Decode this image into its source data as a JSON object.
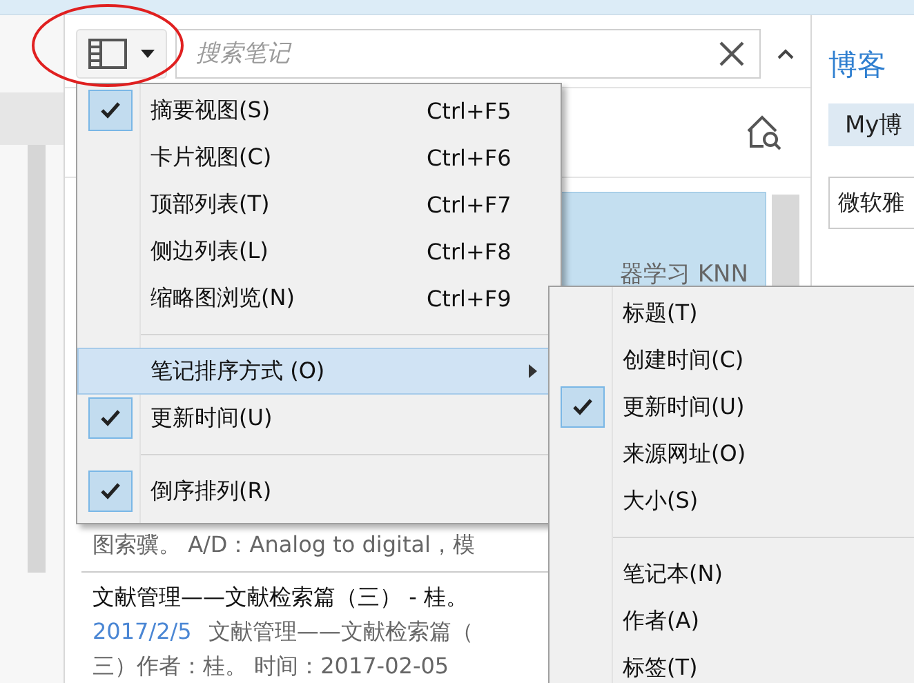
{
  "toolbar": {
    "search": {
      "placeholder": "搜索笔记"
    }
  },
  "notes": [
    {
      "kind": "card",
      "selected": true,
      "title": "器学习 KNN"
    },
    {
      "kind": "snippet",
      "selected": false,
      "text": "图索骥。 A/D：Analog to digital，模"
    },
    {
      "kind": "entry",
      "selected": false,
      "title": "文献管理——文献检索篇（三） - 桂。",
      "date": "2017/2/5",
      "text": "文献管理——文献检索篇（",
      "text_2": "三）作者：桂。 时间：2017-02-05"
    }
  ],
  "right_panel": {
    "heading": "博客",
    "chip": "My博",
    "field_value": "微软雅"
  },
  "view_menu": [
    {
      "kind": "item",
      "label": "摘要视图(S)",
      "shortcut": "Ctrl+F5",
      "checked": true,
      "selected": false
    },
    {
      "kind": "item",
      "label": "卡片视图(C)",
      "shortcut": "Ctrl+F6",
      "checked": false,
      "selected": false
    },
    {
      "kind": "item",
      "label": "顶部列表(T)",
      "shortcut": "Ctrl+F7",
      "checked": false,
      "selected": false
    },
    {
      "kind": "item",
      "label": "侧边列表(L)",
      "shortcut": "Ctrl+F8",
      "checked": false,
      "selected": false
    },
    {
      "kind": "item",
      "label": "缩略图浏览(N)",
      "shortcut": "Ctrl+F9",
      "checked": false,
      "selected": false
    },
    {
      "kind": "separator"
    },
    {
      "kind": "submenu",
      "label": "笔记排序方式 (O)",
      "checked": false,
      "selected": true
    },
    {
      "kind": "item",
      "label": "更新时间(U)",
      "checked": true,
      "selected": false
    },
    {
      "kind": "separator"
    },
    {
      "kind": "item",
      "label": "倒序排列(R)",
      "checked": true,
      "selected": false
    }
  ],
  "sort_menu": [
    {
      "kind": "item",
      "label": "标题(T)",
      "checked": false,
      "selected": false
    },
    {
      "kind": "item",
      "label": "创建时间(C)",
      "checked": false,
      "selected": false
    },
    {
      "kind": "item",
      "label": "更新时间(U)",
      "checked": true,
      "selected": false
    },
    {
      "kind": "item",
      "label": "来源网址(O)",
      "checked": false,
      "selected": false
    },
    {
      "kind": "item",
      "label": "大小(S)",
      "checked": false,
      "selected": false
    },
    {
      "kind": "separator"
    },
    {
      "kind": "item",
      "label": "笔记本(N)",
      "checked": false,
      "selected": false
    },
    {
      "kind": "item",
      "label": "作者(A)",
      "checked": false,
      "selected": false
    },
    {
      "kind": "item",
      "label": "标签(T)",
      "checked": false,
      "selected": false
    }
  ]
}
